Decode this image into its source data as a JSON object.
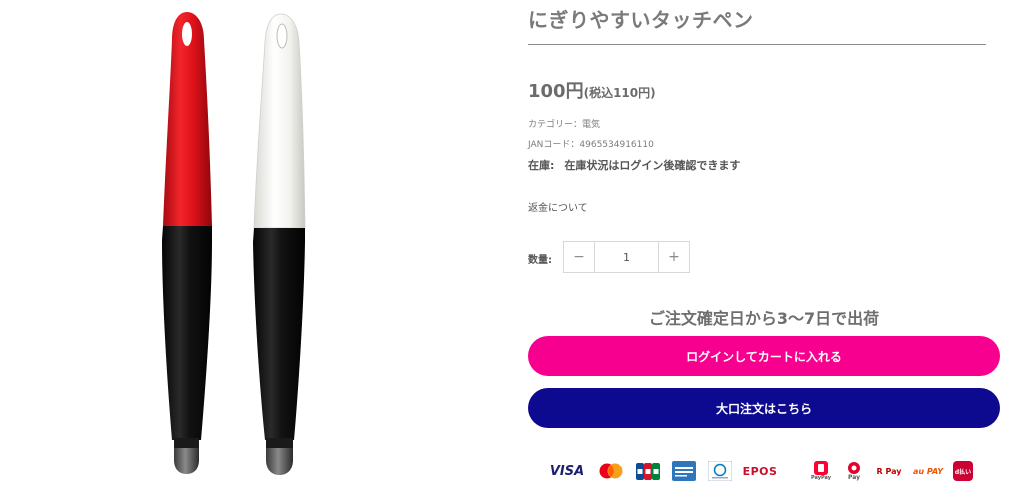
{
  "product": {
    "title": "にぎりやすいタッチペン",
    "price_main": "100円",
    "price_tax": "(税込110円)",
    "category_text": "カテゴリー：電気",
    "jan_text": "JANコード：4965534916110",
    "stock_label": "在庫:",
    "stock_value": "在庫状況はログイン後確認できます",
    "refund_link": "返金について"
  },
  "quantity": {
    "label": "数量:",
    "minus": "−",
    "value": "1",
    "plus": "+"
  },
  "shipping_note": "ご注文確定日から3〜7日で出荷",
  "buttons": {
    "cart": "ログインしてカートに入れる",
    "bulk": "大口注文はこちら"
  },
  "payments": {
    "visa": "VISA",
    "epos": "EPOS",
    "paypay": "PayPay",
    "pay": "Pay",
    "rpay": "R Pay",
    "aupay": "au PAY",
    "docomo": "d払い"
  },
  "colors": {
    "pink_button": "#f7008f",
    "navy_button": "#0d0a8f",
    "pen_red": "#e3141e",
    "pen_white": "#f4f4f1",
    "pen_black": "#111111"
  }
}
